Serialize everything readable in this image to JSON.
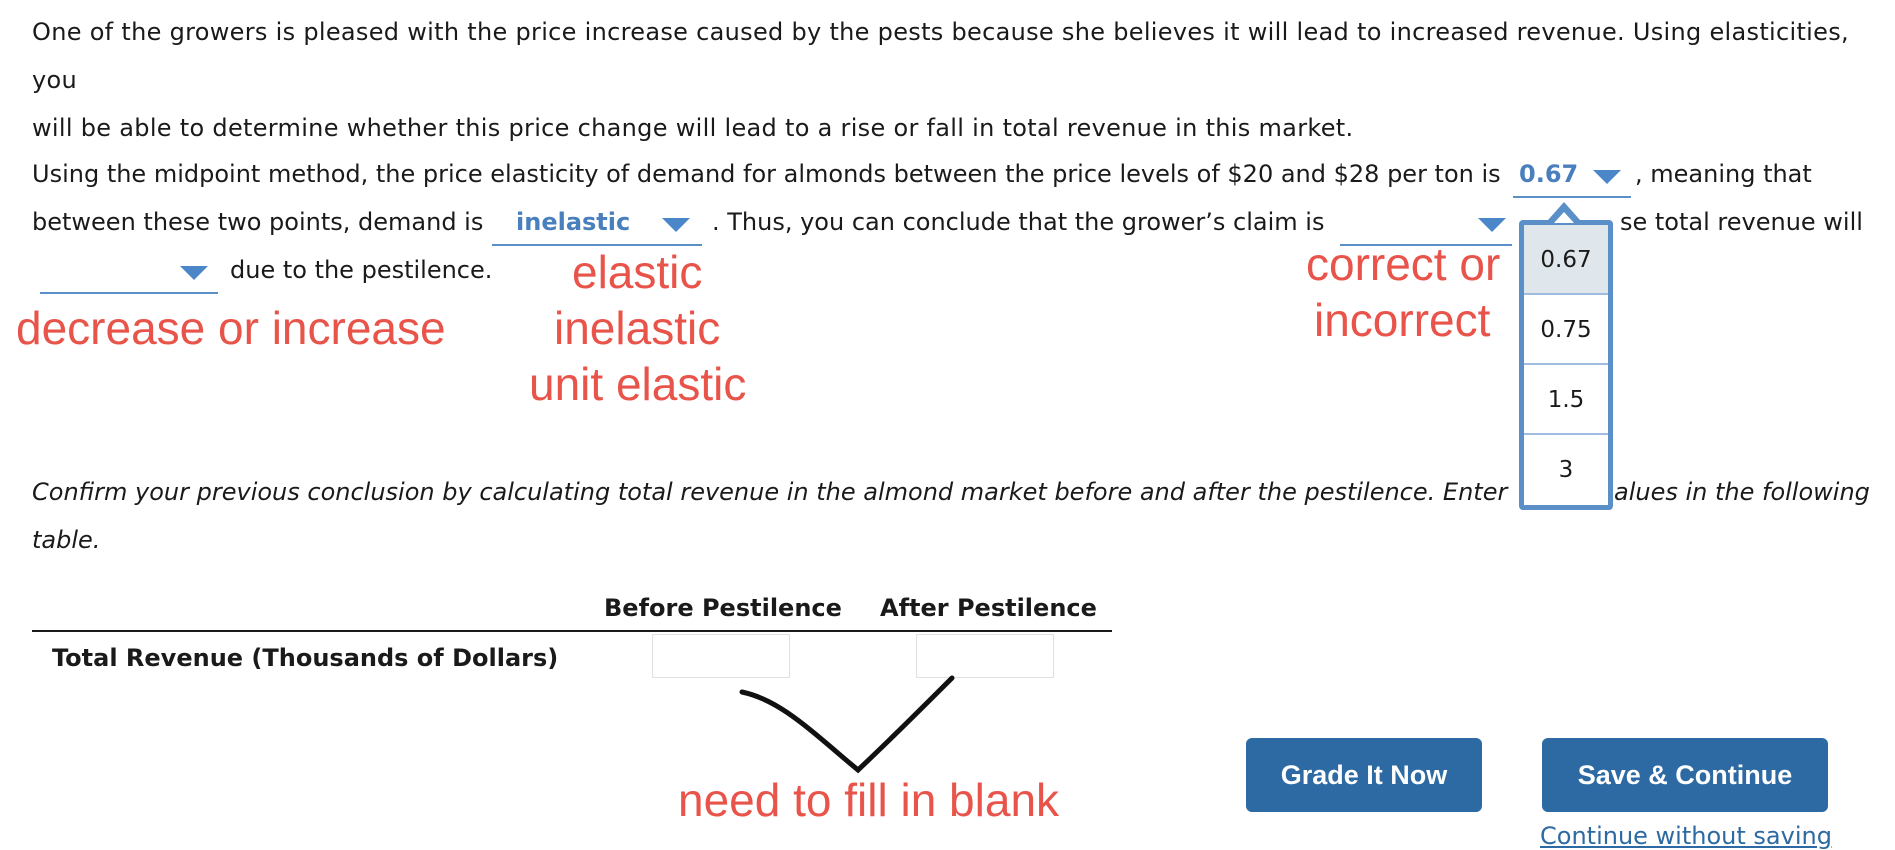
{
  "intro": {
    "line1": "One of the growers is pleased with the price increase caused by the pests because she believes it will lead to increased revenue. Using elasticities, you",
    "line2": "will be able to determine whether this price change will lead to a rise or fall in total revenue in this market."
  },
  "question": {
    "p1_a": "Using the midpoint method, the price elasticity of demand for almonds between the price levels of $20 and $28 per ton is",
    "p1_b": ", meaning that",
    "p2_a": "between these two points, demand is",
    "p2_b": ". Thus, you can conclude that the grower’s claim is",
    "p2_c": "se total revenue will",
    "p3_a": "due to the pestilence."
  },
  "selects": {
    "elasticity_value": "0.67",
    "demand_type": "inelastic",
    "claim": "",
    "revenue_change": ""
  },
  "dropdown_options": [
    "0.67",
    "0.75",
    "1.5",
    "3"
  ],
  "annotations": {
    "elastic_list": [
      "elastic",
      "inelastic",
      "unit elastic"
    ],
    "correct_list": [
      "correct or",
      "incorrect"
    ],
    "decrease": "decrease or increase",
    "fill_blank": "need to fill in blank"
  },
  "confirm": {
    "line1_a": "Confirm your previous conclusion by calculating total revenue in the almond market before and after the pestilence. Enter",
    "line1_b": "alues in the following",
    "line2": "table."
  },
  "table": {
    "col_before": "Before Pestilence",
    "col_after": "After Pestilence",
    "row_label": "Total Revenue (Thousands of Dollars)",
    "before_value": "",
    "after_value": ""
  },
  "buttons": {
    "grade": "Grade It Now",
    "save": "Save & Continue",
    "continue_link": "Continue without saving"
  },
  "colors": {
    "accent": "#4a7fbd",
    "button": "#2d6aa3",
    "annotation": "#e8534a"
  }
}
